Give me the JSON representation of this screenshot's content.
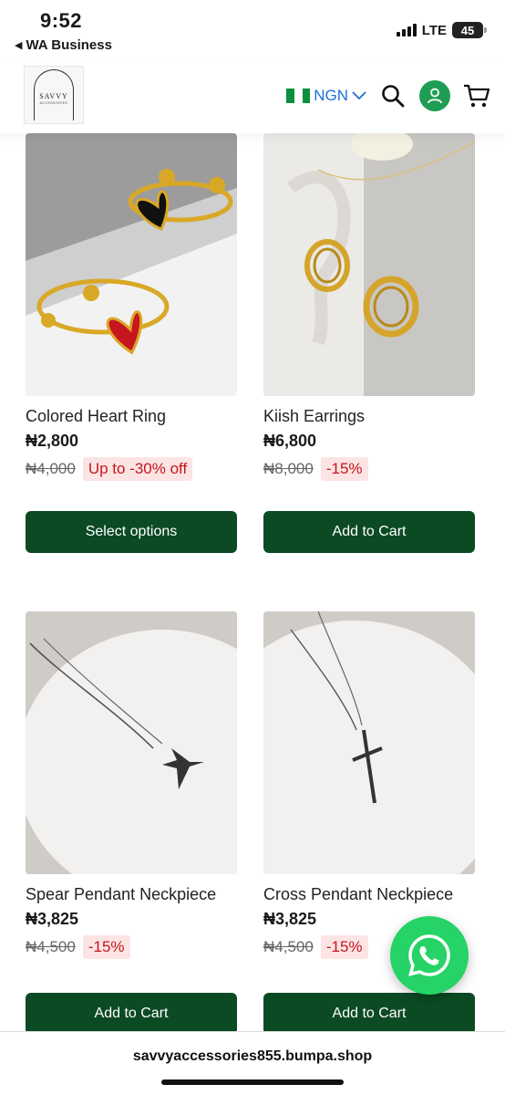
{
  "status_bar": {
    "time": "9:52",
    "back_app": "WA Business",
    "network": "LTE",
    "battery": "45"
  },
  "header": {
    "logo_text": "SAVVY",
    "logo_subtext": "ACCESSORIES",
    "currency": "NGN",
    "flag_colors": [
      "#0a8f3c",
      "#ffffff",
      "#0a8f3c"
    ],
    "icons": [
      "search-icon",
      "user-icon",
      "cart-icon"
    ]
  },
  "products": [
    {
      "name": "Colored Heart Ring",
      "price": "₦2,800",
      "old_price": "₦4,000",
      "discount": "Up to -30% off",
      "button": "Select options"
    },
    {
      "name": "Kiish Earrings",
      "price": "₦6,800",
      "old_price": "₦8,000",
      "discount": "-15%",
      "button": "Add to Cart"
    },
    {
      "name": "Spear Pendant Neckpiece",
      "price": "₦3,825",
      "old_price": "₦4,500",
      "discount": "-15%",
      "button": "Add to Cart"
    },
    {
      "name": "Cross Pendant Neckpiece",
      "price": "₦3,825",
      "old_price": "₦4,500",
      "discount": "-15%",
      "button": "Add to Cart"
    }
  ],
  "whatsapp": {
    "icon": "whatsapp-icon",
    "color": "#25d366"
  },
  "url_bar": {
    "url": "savvyaccessories855.bumpa.shop"
  },
  "theme": {
    "button_color": "#0c4a24",
    "badge_bg": "#fde4e4",
    "badge_text": "#c4161c",
    "currency_color": "#1b6fd8"
  }
}
